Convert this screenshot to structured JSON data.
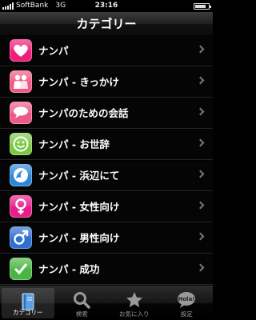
{
  "status_bar": {
    "carrier": "SoftBank",
    "network": "3G",
    "time": "23:16",
    "battery_level": 0.8
  },
  "nav": {
    "title": "カテゴリー"
  },
  "categories": [
    {
      "label": "ナンパ",
      "icon": "heart-icon",
      "color": "#ef1f7a"
    },
    {
      "label": "ナンパ - きっかけ",
      "icon": "couple-icon",
      "color": "#f0587f"
    },
    {
      "label": "ナンパのための会話",
      "icon": "speech-bubbles-icon",
      "color": "#ee5a86"
    },
    {
      "label": "ナンパ - お世辞",
      "icon": "smiley-icon",
      "color": "#7ac943"
    },
    {
      "label": "ナンパ - 浜辺にて",
      "icon": "wave-icon",
      "color": "#2f86d6"
    },
    {
      "label": "ナンパ - 女性向け",
      "icon": "female-symbol-icon",
      "color": "#e81d8c"
    },
    {
      "label": "ナンパ - 男性向け",
      "icon": "male-symbol-icon",
      "color": "#2e6fd0"
    },
    {
      "label": "ナンパ - 成功",
      "icon": "checkmark-icon",
      "color": "#4bb543"
    }
  ],
  "tabs": [
    {
      "label": "カテゴリー",
      "icon": "book-icon",
      "active": true
    },
    {
      "label": "検索",
      "icon": "magnifier-icon",
      "active": false
    },
    {
      "label": "お気に入り",
      "icon": "star-icon",
      "active": false
    },
    {
      "label": "設定",
      "icon": "hola-bubble-icon",
      "icon_text": "Hola!",
      "active": false
    }
  ]
}
